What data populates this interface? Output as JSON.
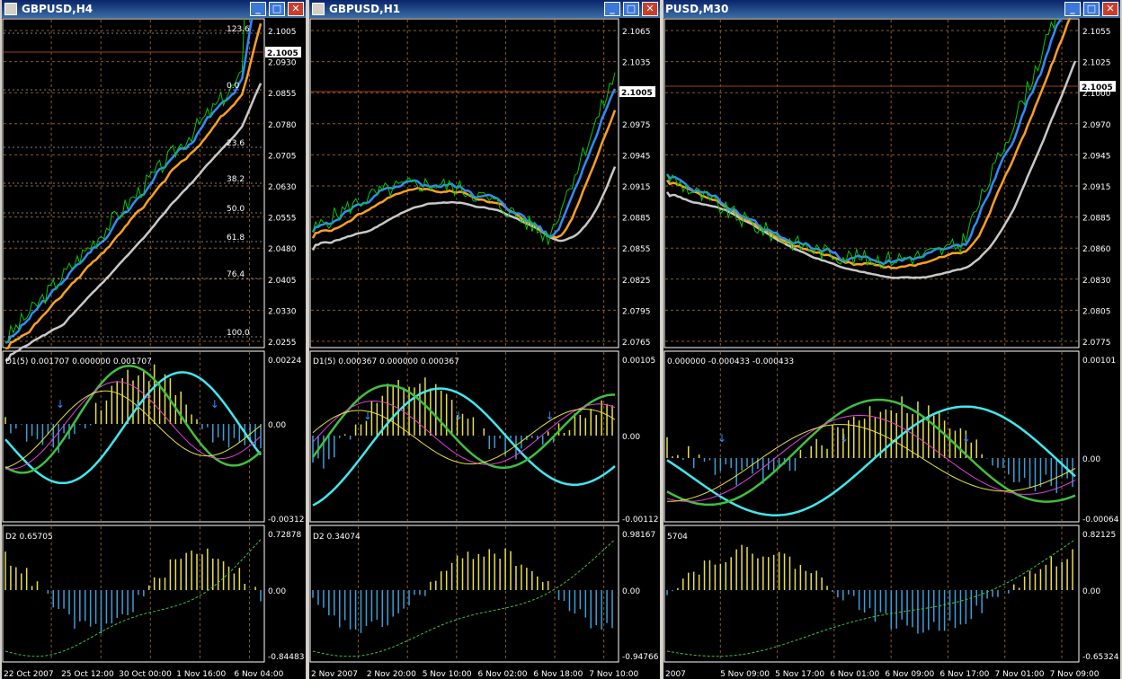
{
  "windows": [
    {
      "title": "GBPUSD,H4",
      "buttons": {
        "minimize": "_",
        "maximize": "□",
        "close": "✕"
      },
      "price_labels": [
        "2.1005",
        "2.0930",
        "2.0855",
        "2.0780",
        "2.0705",
        "2.0630",
        "2.0555",
        "2.0480",
        "2.0405",
        "2.0330",
        "2.0255"
      ],
      "current_price": "2.1005",
      "fib_labels": [
        "123.6",
        "0.0",
        "23.6",
        "38.2",
        "50.0",
        "61.8",
        "76.4",
        "100.0"
      ],
      "d1_header": "D1(5) 0.001707 0.000000 0.001707",
      "d1_scale": [
        "0.00224",
        "0.00",
        "-0.00312"
      ],
      "d2_header": "D2 0.65705",
      "d2_scale": [
        "0.72878",
        "0.00",
        "-0.84483"
      ],
      "time_labels": [
        "22 Oct 2007",
        "25 Oct 12:00",
        "30 Oct 00:00",
        "1 Nov 16:00",
        "6 Nov 04:00"
      ]
    },
    {
      "title": "GBPUSD,H1",
      "buttons": {
        "minimize": "_",
        "maximize": "□",
        "close": "✕"
      },
      "price_labels": [
        "2.1065",
        "2.1035",
        "2.1005",
        "2.0975",
        "2.0945",
        "2.0915",
        "2.0885",
        "2.0855",
        "2.0825",
        "2.0795",
        "2.0765"
      ],
      "current_price": "2.1005",
      "d1_header": "D1(5) 0.000367 0.000000 0.000367",
      "d1_scale": [
        "0.00105",
        "0.00",
        "-0.00112"
      ],
      "d2_header": "D2 0.34074",
      "d2_scale": [
        "0.98167",
        "0.00",
        "-0.94766"
      ],
      "time_labels": [
        "2 Nov 2007",
        "2 Nov 20:00",
        "5 Nov 10:00",
        "6 Nov 02:00",
        "6 Nov 18:00",
        "7 Nov 10:00"
      ]
    },
    {
      "title": "PUSD,M30",
      "buttons": {
        "minimize": "_",
        "maximize": "□",
        "close": "✕"
      },
      "price_labels": [
        "2.1055",
        "2.1025",
        "2.1000",
        "2.0970",
        "2.0945",
        "2.0915",
        "2.0885",
        "2.0860",
        "2.0830",
        "2.0805",
        "2.0775"
      ],
      "current_price": "2.1005",
      "d1_header": "0.000000 -0.000433 -0.000433",
      "d1_scale": [
        "0.00101",
        "0.00",
        "-0.00064"
      ],
      "d2_header": "5704",
      "d2_scale": [
        "0.82125",
        "0.00",
        "-0.65324"
      ],
      "time_labels": [
        "2007",
        "5 Nov 09:00",
        "5 Nov 17:00",
        "6 Nov 01:00",
        "6 Nov 09:00",
        "6 Nov 17:00",
        "7 Nov 01:00",
        "7 Nov 09:00"
      ]
    }
  ],
  "colors": {
    "grid": "#8a5a2a",
    "axis_text": "#ffffff",
    "price": "#00c800",
    "ma_fast": "#2f8cff",
    "ma_mid": "#ffa020",
    "ma_slow": "#c8c8c8",
    "hist_pos": "#e8e040",
    "hist_neg": "#3aa0d8",
    "cyan": "#40e8f0",
    "magenta": "#e040e0",
    "hline": "#a04020"
  }
}
